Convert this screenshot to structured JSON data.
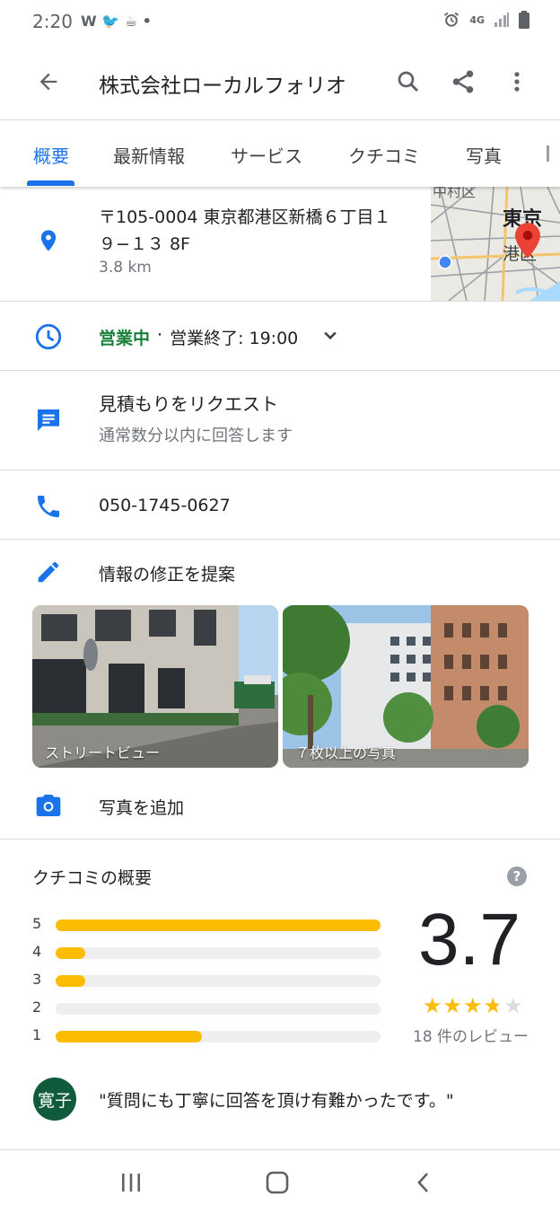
{
  "status_bar": {
    "time": "2:20",
    "notification_icons": "W 🐦 ☕ •",
    "network": "4G",
    "icons": [
      "alarm-icon",
      "signal-icon",
      "battery-icon"
    ]
  },
  "app_bar": {
    "title": "株式会社ローカルフォリオ"
  },
  "tabs": [
    {
      "label": "概要",
      "active": true
    },
    {
      "label": "最新情報"
    },
    {
      "label": "サービス"
    },
    {
      "label": "クチコミ"
    },
    {
      "label": "写真"
    }
  ],
  "address": {
    "line1": "〒105-0004 東京都港区新橋６丁目１",
    "line2": "９−１３ 8F",
    "distance": "3.8 km"
  },
  "map": {
    "label1": "東京",
    "label2": "港区",
    "label3": "中村区"
  },
  "hours": {
    "status": "営業中",
    "separator": "·",
    "close": "営業終了: 19:00"
  },
  "quote": {
    "title": "見積もりをリクエスト",
    "subtitle": "通常数分以内に回答します"
  },
  "phone": "050-1745-0627",
  "suggest_edit": "情報の修正を提案",
  "photos": [
    {
      "label": "ストリートビュー"
    },
    {
      "label": "７枚以上の写真"
    }
  ],
  "add_photo": "写真を追加",
  "reviews": {
    "heading": "クチコミの概要",
    "rating": "3.7",
    "stars_value": 3.7,
    "count_label": "18 件のレビュー",
    "distribution": [
      {
        "label": "5",
        "fraction": 1.0
      },
      {
        "label": "4",
        "fraction": 0.09
      },
      {
        "label": "3",
        "fraction": 0.09
      },
      {
        "label": "2",
        "fraction": 0.0
      },
      {
        "label": "1",
        "fraction": 0.45
      }
    ],
    "snippet_avatar": "寛子",
    "snippet": "\"質問にも丁寧に回答を頂け有難かったです。\""
  },
  "colors": {
    "accent": "#1a73e8",
    "open_green": "#188038",
    "star": "#fbbc04"
  }
}
